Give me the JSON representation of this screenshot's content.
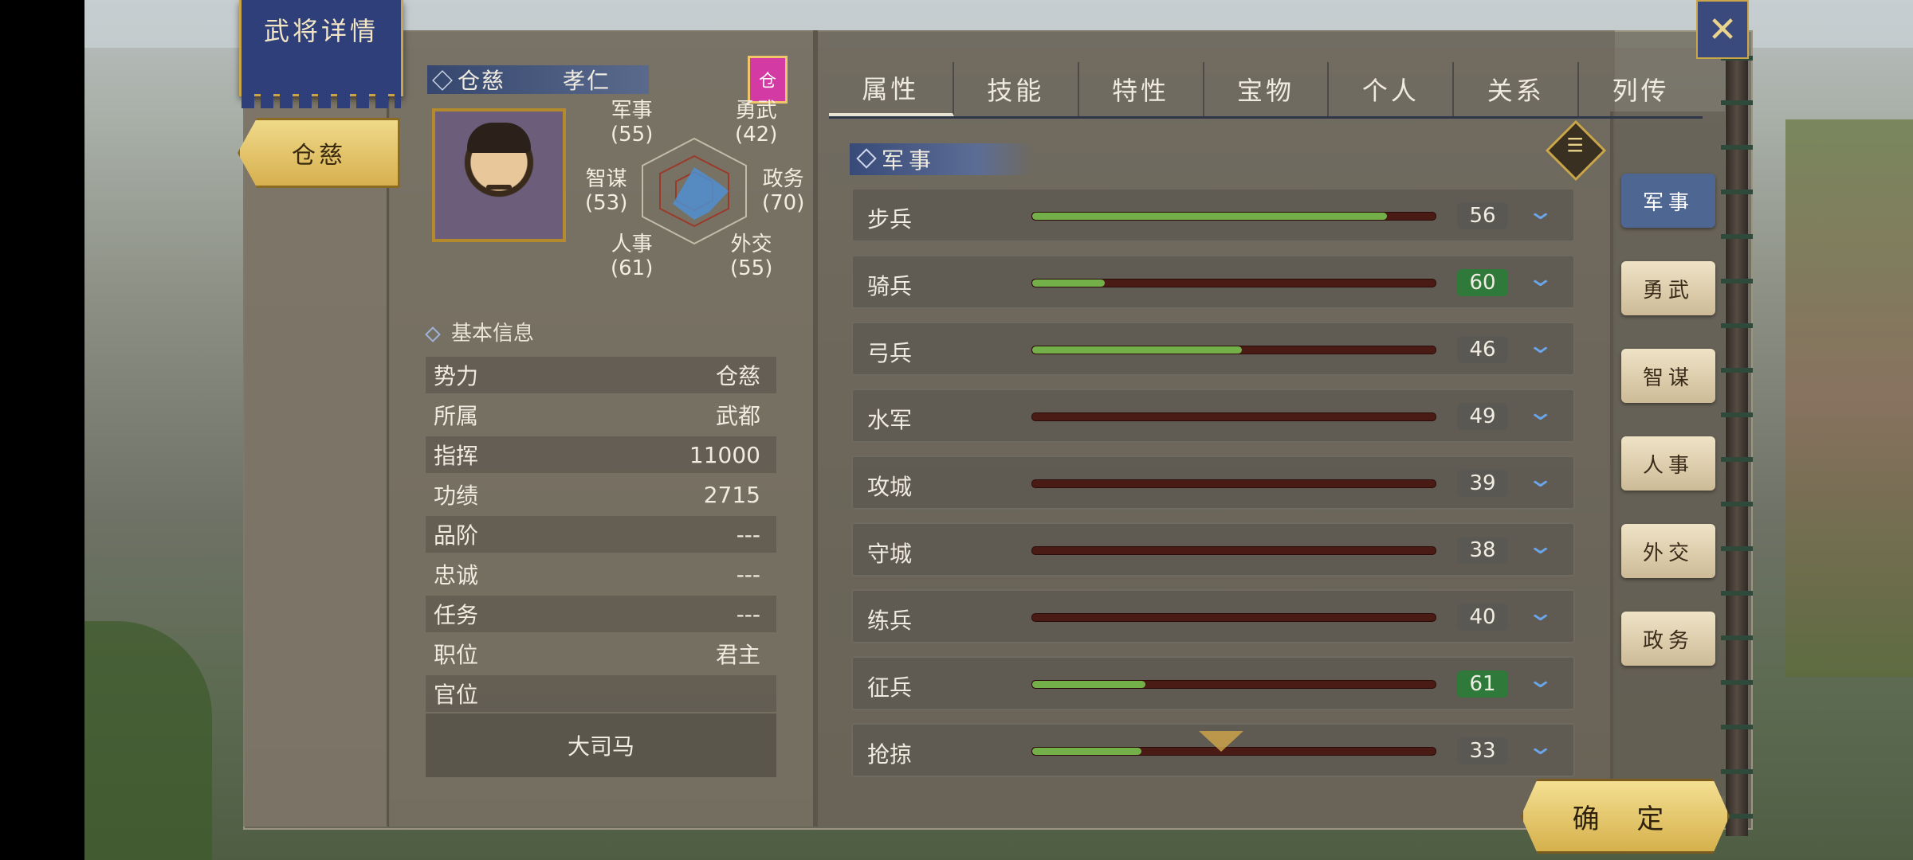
{
  "window": {
    "title": "武将详情"
  },
  "general": {
    "name_tab": "仓慈",
    "family_name": "仓慈",
    "courtesy_name": "孝仁",
    "faction_badge": "仓",
    "faction_badge_color": "#d43aa3"
  },
  "radar": {
    "military": {
      "label": "军事",
      "value": "(55)"
    },
    "valor": {
      "label": "勇武",
      "value": "(42)"
    },
    "strategy": {
      "label": "智谋",
      "value": "(53)"
    },
    "politics": {
      "label": "政务",
      "value": "(70)"
    },
    "personnel": {
      "label": "人事",
      "value": "(61)"
    },
    "diplomacy": {
      "label": "外交",
      "value": "(55)"
    }
  },
  "basic_info": {
    "title": "基本信息",
    "rows": [
      {
        "label": "势力",
        "value": "仓慈"
      },
      {
        "label": "所属",
        "value": "武都"
      },
      {
        "label": "指挥",
        "value": "11000"
      },
      {
        "label": "功绩",
        "value": "2715"
      },
      {
        "label": "品阶",
        "value": "---"
      },
      {
        "label": "忠诚",
        "value": "---"
      },
      {
        "label": "任务",
        "value": "---"
      },
      {
        "label": "职位",
        "value": "君主"
      },
      {
        "label": "官位",
        "value": ""
      }
    ],
    "office_title": "大司马"
  },
  "tabs": [
    "属性",
    "技能",
    "特性",
    "宝物",
    "个人",
    "关系",
    "列传"
  ],
  "active_tab": "属性",
  "category": {
    "title": "军事"
  },
  "skills": [
    {
      "name": "步兵",
      "value": "56",
      "fill": 0.88,
      "highlight": false
    },
    {
      "name": "骑兵",
      "value": "60",
      "fill": 0.18,
      "highlight": true
    },
    {
      "name": "弓兵",
      "value": "46",
      "fill": 0.52,
      "highlight": false
    },
    {
      "name": "水军",
      "value": "49",
      "fill": 0.0,
      "highlight": false
    },
    {
      "name": "攻城",
      "value": "39",
      "fill": 0.0,
      "highlight": false
    },
    {
      "name": "守城",
      "value": "38",
      "fill": 0.0,
      "highlight": false
    },
    {
      "name": "练兵",
      "value": "40",
      "fill": 0.0,
      "highlight": false
    },
    {
      "name": "征兵",
      "value": "61",
      "fill": 0.28,
      "highlight": true
    },
    {
      "name": "抢掠",
      "value": "33",
      "fill": 0.27,
      "highlight": false
    }
  ],
  "side_tabs": [
    "军事",
    "勇武",
    "智谋",
    "人事",
    "外交",
    "政务"
  ],
  "active_side_tab": "军事",
  "confirm_label": "确 定",
  "icons": {
    "close": "close-icon",
    "list": "list-icon",
    "expand": "chevron-down-icon"
  },
  "colors": {
    "bar_fill": "#74b04a",
    "bar_track": "#4a1b14",
    "value_highlight": "#2f7a3a",
    "banner": "#2f3f7a",
    "gold": "#d7b04f"
  }
}
